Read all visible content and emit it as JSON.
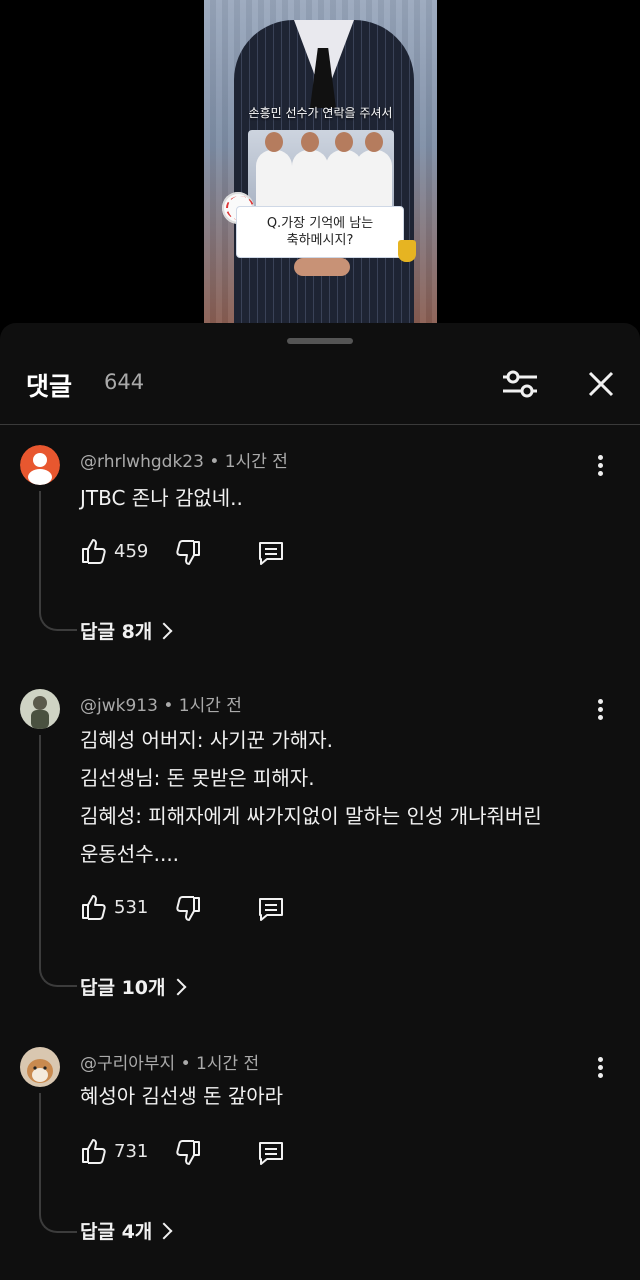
{
  "video": {
    "caption": "손흥민 선수가 연락을 주셔서",
    "question_line1": "Q.가장 기억에 남는",
    "question_line2": "축하메시지?"
  },
  "header": {
    "title": "댓글",
    "count": "644"
  },
  "comments": [
    {
      "author": "@rhrlwhgdk23",
      "time": "1시간 전",
      "lines": [
        "JTBC 존나 감없네.."
      ],
      "likes": "459",
      "replies": "답글 8개",
      "avatar": "default-orange-avatar"
    },
    {
      "author": "@jwk913",
      "time": "1시간 전",
      "lines": [
        "김혜성 어버지:  사기꾼 가해자.",
        "김선생님:  돈 못받은 피해자.",
        "김혜성:  피해자에게 싸가지없이 말하는 인성 개나줘버린",
        "운동선수...."
      ],
      "likes": "531",
      "replies": "답글 10개",
      "avatar": "photo-avatar"
    },
    {
      "author": "@구리아부지",
      "time": "1시간 전",
      "lines": [
        "혜성아 김선생 돈 갚아라"
      ],
      "likes": "731",
      "replies": "답글 4개",
      "avatar": "dog-photo-avatar"
    }
  ],
  "colors": {
    "sheet_bg": "#0f0f0f",
    "default_avatar": "#e8572f"
  }
}
